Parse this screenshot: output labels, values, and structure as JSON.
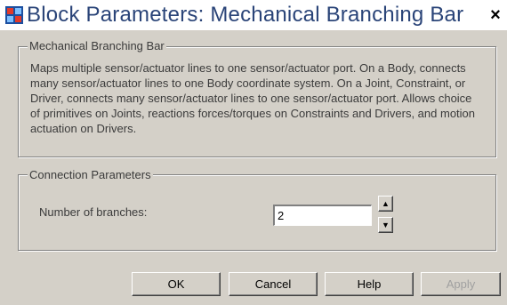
{
  "window": {
    "title": "Block Parameters: Mechanical Branching Bar",
    "close_label": "×"
  },
  "description_group": {
    "legend": "Mechanical Branching Bar",
    "text": "Maps multiple sensor/actuator lines to one sensor/actuator port. On a Body, connects many sensor/actuator lines to one Body coordinate system. On a Joint, Constraint, or Driver, connects many sensor/actuator lines to one sensor/actuator port. Allows choice of primitives on Joints, reactions forces/torques on Constraints and Drivers, and motion actuation on Drivers."
  },
  "parameters_group": {
    "legend": "Connection Parameters",
    "branches_label": "Number of branches:",
    "branches_value": "2",
    "spin_up_icon": "arrow-up-icon",
    "spin_down_icon": "arrow-down-icon"
  },
  "buttons": {
    "ok": "OK",
    "cancel": "Cancel",
    "help": "Help",
    "apply": "Apply"
  }
}
